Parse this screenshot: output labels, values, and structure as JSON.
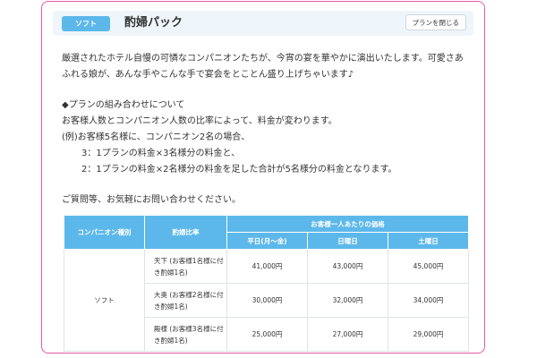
{
  "header": {
    "tag": "ソフト",
    "title": "酌婦パック",
    "close_button": "プランを閉じる"
  },
  "intro_lines": [
    "厳選されたホテル自慢の可憐なコンパニオンたちが、今宵の宴を華やかに演出いたします。可愛さあ",
    "ふれる娘が、あんな手やこんな手で宴会をとことん盛り上げちゃいます♪"
  ],
  "combo": {
    "heading": "◆プランの組み合わせについて",
    "line1": "お客様人数とコンパニオン人数の比率によって、料金が変わります。",
    "line2": "(例)お客様5名様に、コンパニオン2名の場合、",
    "line3": "3：1プランの料金×3名様分の料金と、",
    "line4": "2：1プランの料金×2名様分の料金を足した合計が5名様分の料金となります。"
  },
  "contact": "ご質問等、お気軽にお問い合わせください。",
  "table": {
    "col_type": "コンパニオン種別",
    "col_ratio": "酌婦比率",
    "col_price_group": "お客様一人あたりの価格",
    "col_weekday": "平日(月～金)",
    "col_sunday": "日曜日",
    "col_saturday": "土曜日",
    "type_value": "ソフト",
    "rows": [
      {
        "ratio": "天下 (お客様1名様に付き酌婦1名)",
        "weekday": "41,000円",
        "sunday": "43,000円",
        "saturday": "45,000円"
      },
      {
        "ratio": "大奥 (お客様2名様に付き酌婦1名)",
        "weekday": "30,000円",
        "sunday": "32,000円",
        "saturday": "34,000円"
      },
      {
        "ratio": "殿様 (お客様3名様に付き酌婦1名)",
        "weekday": "25,000円",
        "sunday": "27,000円",
        "saturday": "29,000円"
      }
    ]
  },
  "colors": {
    "accent": "#5cb8ea",
    "frame_border": "#e25aa8",
    "header_bg": "#eef6fc"
  }
}
